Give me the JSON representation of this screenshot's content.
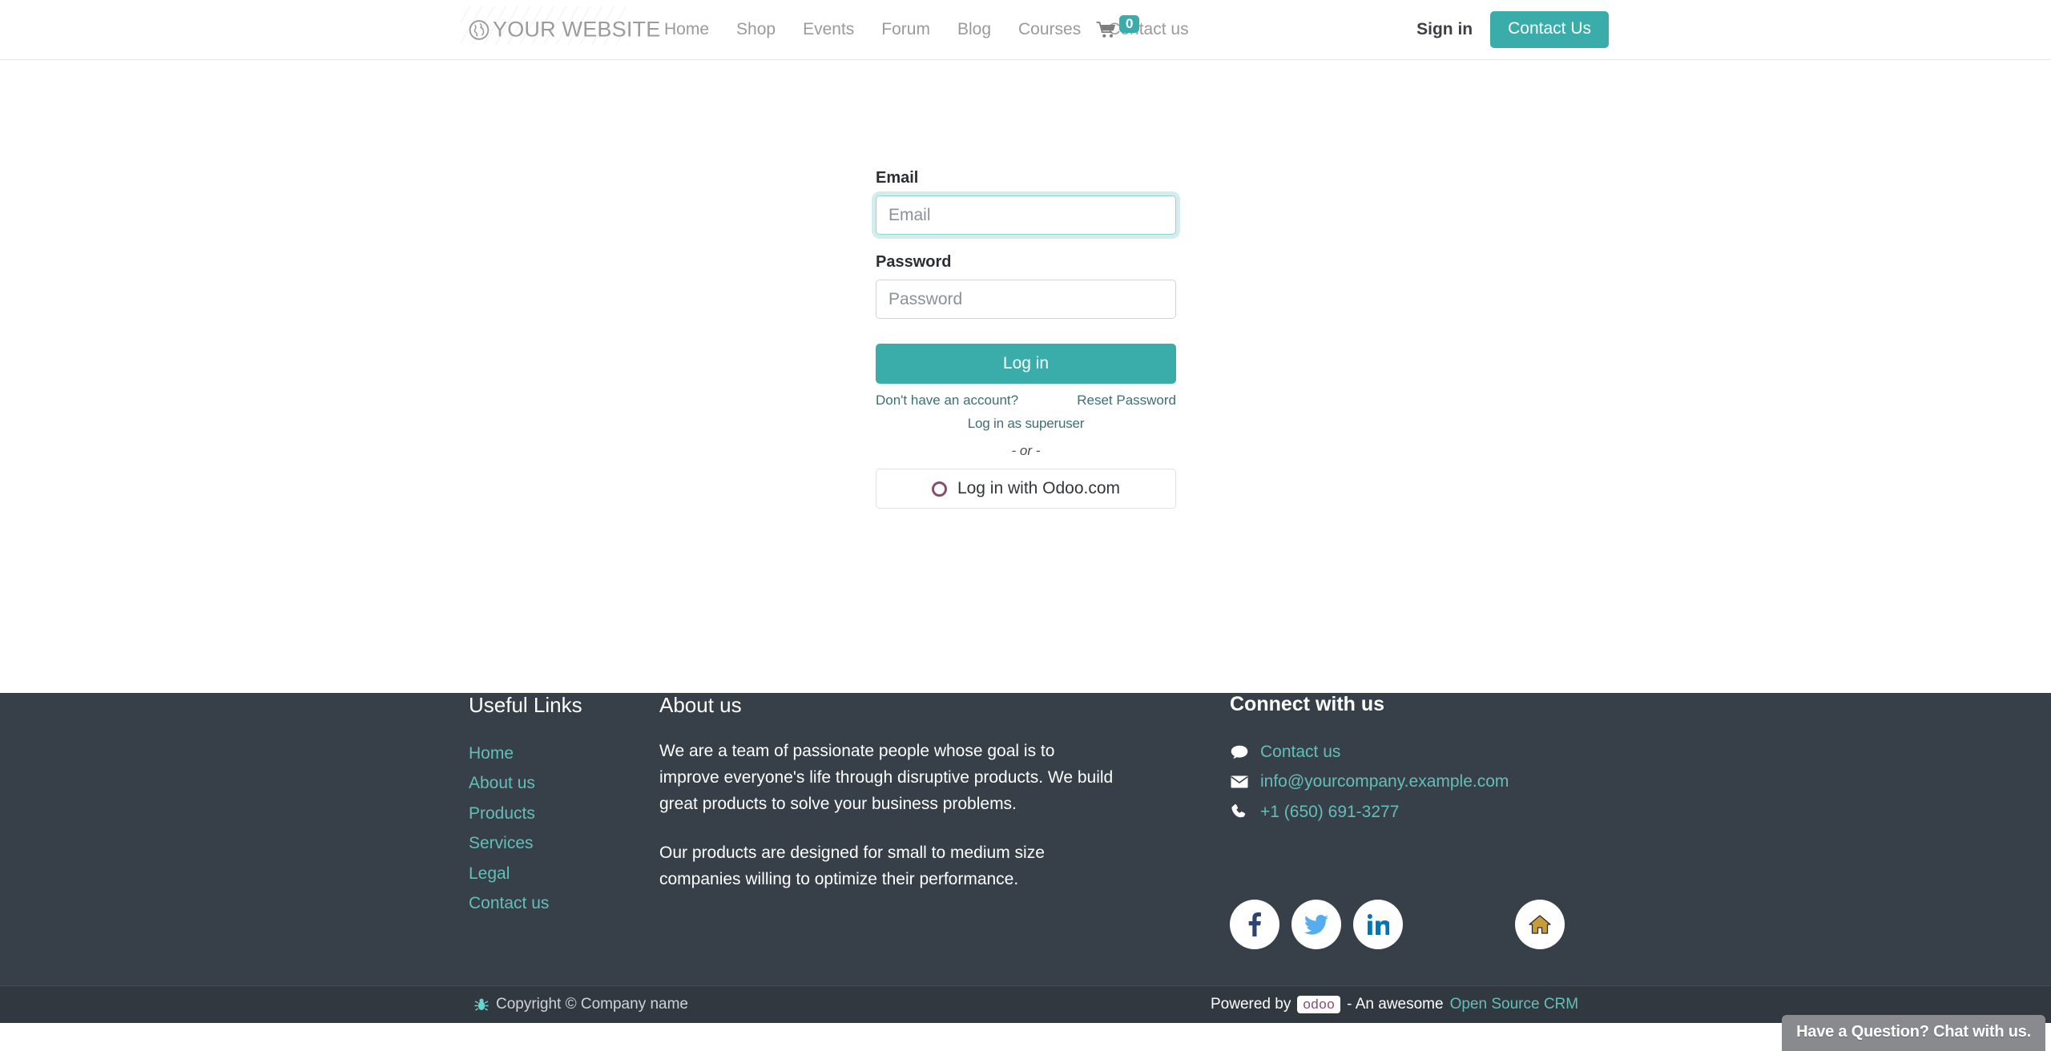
{
  "navbar": {
    "brand": {
      "text": "YOUR WEBSITE",
      "icon": "globe-icon"
    },
    "links": [
      {
        "label": "Home"
      },
      {
        "label": "Shop"
      },
      {
        "label": "Events"
      },
      {
        "label": "Forum"
      },
      {
        "label": "Blog"
      },
      {
        "label": "Courses"
      },
      {
        "label": "Contact us"
      }
    ],
    "cart": {
      "icon": "shopping-cart-icon",
      "count": "0"
    },
    "sign_in_label": "Sign in",
    "contact_button_label": "Contact Us"
  },
  "login": {
    "email_label": "Email",
    "email_placeholder": "Email",
    "email_value": "",
    "password_label": "Password",
    "password_placeholder": "Password",
    "password_value": "",
    "submit_label": "Log in",
    "no_account_label": "Don't have an account?",
    "reset_password_label": "Reset Password",
    "superuser_label": "Log in as superuser",
    "or_label": "- or -",
    "oauth_label": "Log in with Odoo.com",
    "oauth_icon": "odoo-ring-icon"
  },
  "footer": {
    "useful_links": {
      "heading": "Useful Links",
      "items": [
        {
          "label": "Home"
        },
        {
          "label": "About us"
        },
        {
          "label": "Products"
        },
        {
          "label": "Services"
        },
        {
          "label": "Legal"
        },
        {
          "label": "Contact us"
        }
      ]
    },
    "about": {
      "heading": "About us",
      "paragraph1": "We are a team of passionate people whose goal is to improve everyone's life through disruptive products. We build great products to solve your business problems.",
      "paragraph2": "Our products are designed for small to medium size companies willing to optimize their performance."
    },
    "connect": {
      "heading": "Connect with us",
      "contact_label": "Contact us",
      "contact_icon": "comment-icon",
      "email": "info@yourcompany.example.com",
      "email_icon": "envelope-icon",
      "phone": "+1 (650) 691-3277",
      "phone_icon": "phone-icon",
      "socials": [
        {
          "name": "facebook-icon"
        },
        {
          "name": "twitter-icon"
        },
        {
          "name": "linkedin-icon"
        },
        {
          "name": "home-icon"
        }
      ]
    },
    "copyright": {
      "icon": "bug-icon",
      "text": "Copyright © Company name",
      "powered_prefix": "Powered by",
      "odoo_logo": "odoo",
      "powered_middle": "- An awesome",
      "crm_link": "Open Source CRM"
    }
  },
  "chat": {
    "label": "Have a Question? Chat with us."
  },
  "colors": {
    "accent": "#3aadaa",
    "footer_bg": "#373f48",
    "footer_link": "#62bfba",
    "copybar_bg": "#32383f",
    "chat_bg": "#888a8d"
  }
}
